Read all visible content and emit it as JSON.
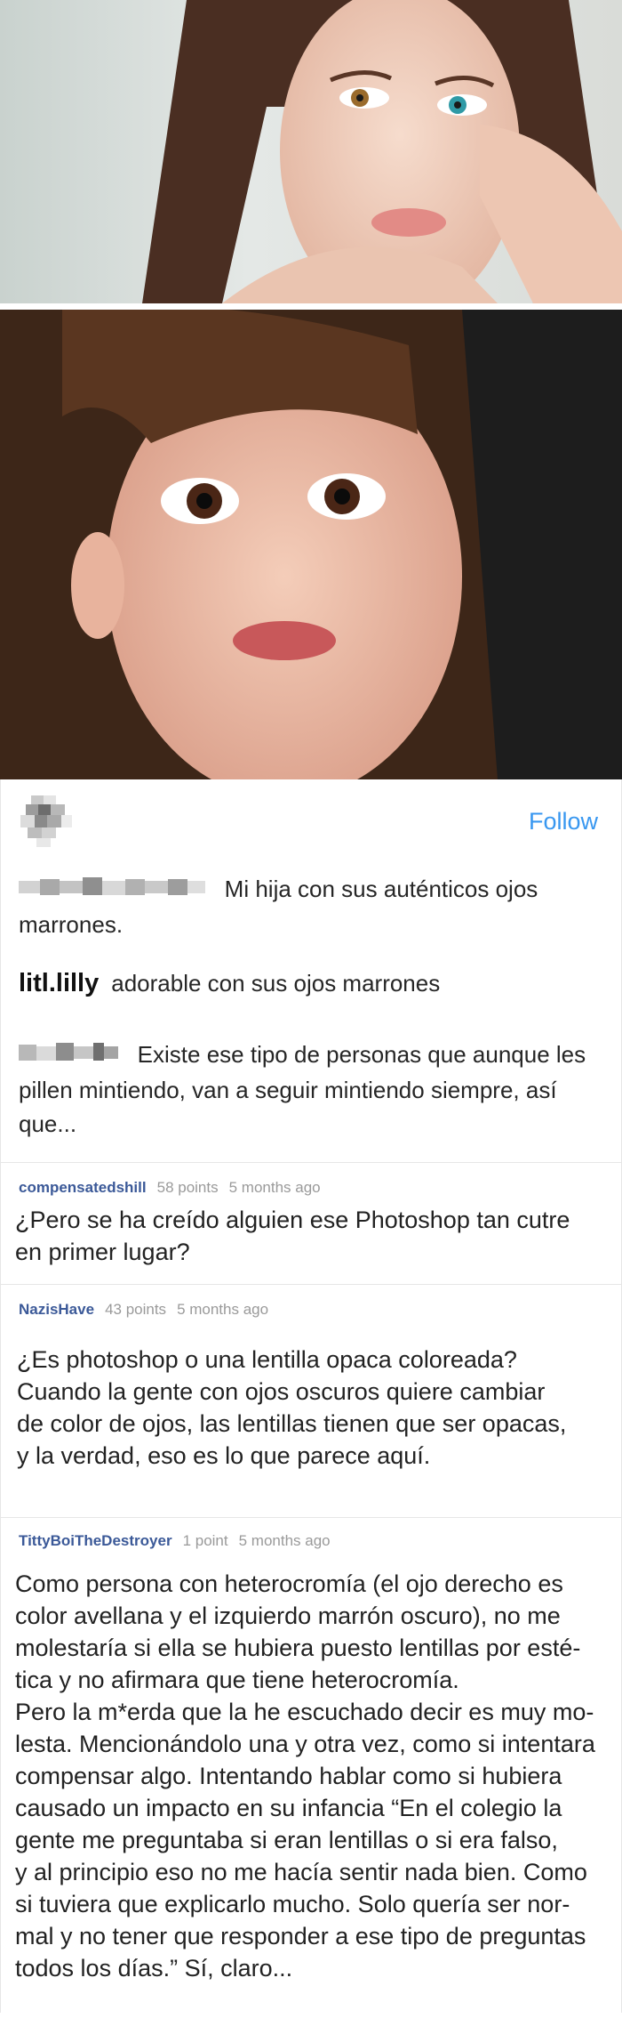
{
  "photos": [
    {
      "alt": "adult woman with heterochromia"
    },
    {
      "alt": "child with brown eyes"
    }
  ],
  "instagram": {
    "follow_label": "Follow",
    "comments": [
      {
        "username": "",
        "text": "Mi hija con sus auténticos ojos marrones."
      },
      {
        "username": "litl.lilly",
        "text": "adorable con sus ojos marrones"
      },
      {
        "username": "",
        "text": "Existe ese tipo de personas que aunque les pillen mintiendo, van a seguir mintiendo siempre, así que..."
      }
    ]
  },
  "comments": [
    {
      "user": "compensatedshill",
      "points": "58 points",
      "time": "5 months ago",
      "lines": [
        "¿Pero se ha creído alguien ese Photoshop tan cutre",
        "en primer lugar?"
      ]
    },
    {
      "user": "NazisHave",
      "points": "43 points",
      "time": "5 months ago",
      "lines": [
        "¿Es photoshop o una lentilla opaca coloreada?",
        "Cuando la gente con ojos oscuros quiere cambiar",
        "de color de ojos, las lentillas tienen que ser opacas,",
        "y la verdad, eso es lo que parece aquí."
      ]
    },
    {
      "user": "TittyBoiTheDestroyer",
      "points": "1 point",
      "time": "5 months ago",
      "lines": [
        "Como persona con heterocromía (el ojo derecho es",
        "color avellana y el izquierdo marrón oscuro), no me",
        "molestaría si ella se hubiera puesto lentillas por esté-",
        "tica y no afirmara que tiene heterocromía.",
        "Pero la m*erda que la he escuchado decir es muy mo-",
        "lesta. Mencionándolo una y otra vez, como si intentara",
        "compensar algo. Intentando hablar como si hubiera",
        "causado un impacto en su infancia “En el colegio la",
        "gente me preguntaba si eran lentillas o si era falso,",
        "y al principio eso no me hacía sentir nada bien. Como",
        "si tuviera que explicarlo mucho. Solo quería ser nor-",
        "mal y no tener que responder a ese tipo de preguntas",
        "todos los días.” Sí, claro..."
      ]
    }
  ]
}
